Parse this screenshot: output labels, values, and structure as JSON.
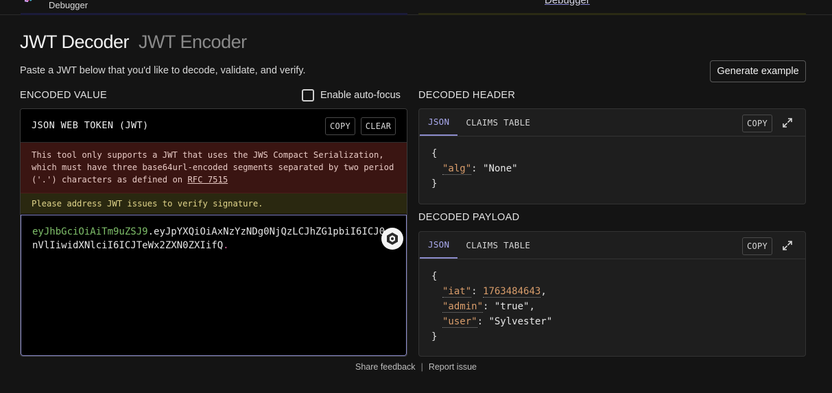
{
  "topbar": {
    "brand": "Debugger",
    "nav_active": "Debugger"
  },
  "tabs": {
    "active": "JWT Decoder",
    "inactive": "JWT Encoder"
  },
  "subtitle": "Paste a JWT below that you'd like to decode, validate, and verify.",
  "generate_button": "Generate example",
  "encoded": {
    "section_label": "ENCODED VALUE",
    "autofocus_label": "Enable auto-focus",
    "panel_title": "JSON WEB TOKEN (JWT)",
    "copy": "COPY",
    "clear": "CLEAR",
    "error_text": "This tool only supports a JWT that uses the JWS Compact Serialization, which must have three base64url-encoded segments separated by two period ('.') characters as defined on ",
    "error_link": "RFC 7515",
    "warning": "Please address JWT issues to verify signature.",
    "token_header": "eyJhbGciOiAiTm9uZSJ9",
    "token_payload": "eyJpYXQiOiAxNzYzNDg0NjQzLCJhZG1pbiI6ICJ0cnVlIiwidXNlciI6ICJTeWx2ZXN0ZXIifQ",
    "dot": "."
  },
  "header": {
    "section_label": "DECODED HEADER",
    "tab_json": "JSON",
    "tab_claims": "CLAIMS TABLE",
    "copy": "COPY",
    "open": "{",
    "close": "}",
    "alg_key": "\"alg\"",
    "alg_val": "\"None\""
  },
  "payload": {
    "section_label": "DECODED PAYLOAD",
    "tab_json": "JSON",
    "tab_claims": "CLAIMS TABLE",
    "copy": "COPY",
    "open": "{",
    "close": "}",
    "iat_key": "\"iat\"",
    "iat_val": "1763484643",
    "admin_key": "\"admin\"",
    "admin_val": "\"true\"",
    "user_key": "\"user\"",
    "user_val": "\"Sylvester\""
  },
  "footer": {
    "feedback": "Share feedback",
    "separator": "|",
    "report": "Report issue"
  }
}
